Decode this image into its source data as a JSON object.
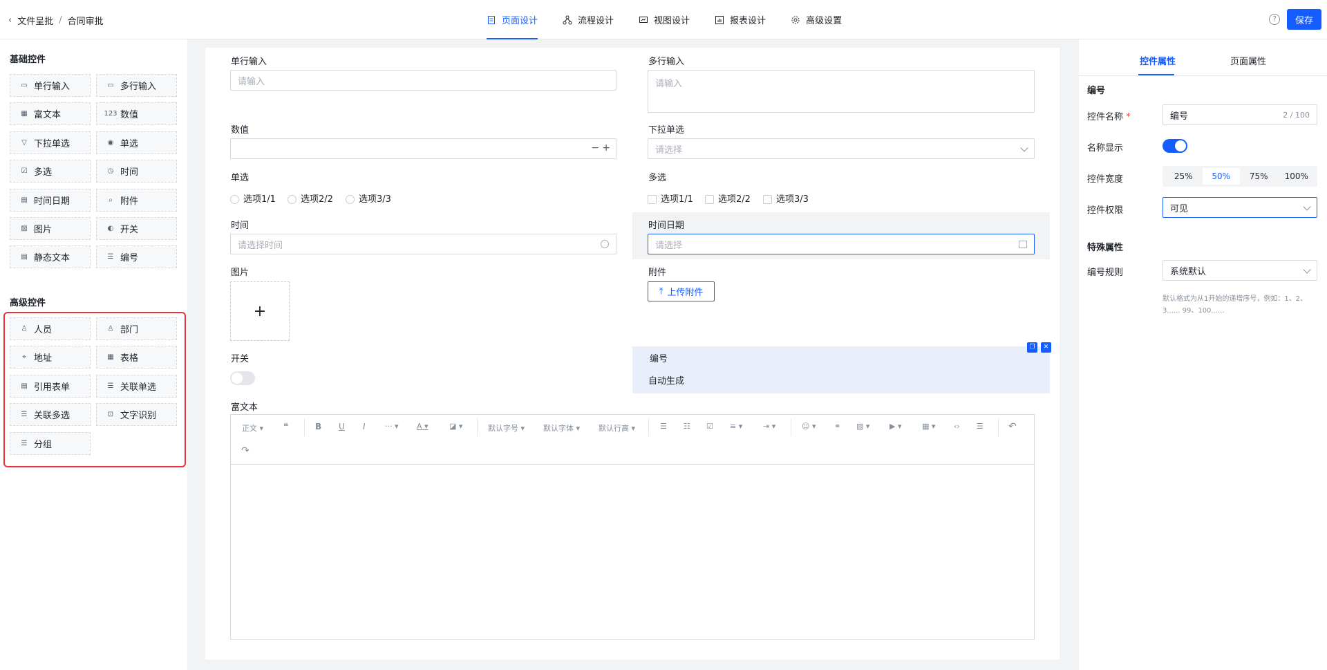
{
  "header": {
    "breadcrumb": [
      "文件呈批",
      "合同审批"
    ],
    "breadcrumb_sep": "/",
    "tabs": [
      {
        "label": "页面设计",
        "icon": "file-icon",
        "active": true
      },
      {
        "label": "流程设计",
        "icon": "flow-icon",
        "active": false
      },
      {
        "label": "视图设计",
        "icon": "view-icon",
        "active": false
      },
      {
        "label": "报表设计",
        "icon": "report-icon",
        "active": false
      },
      {
        "label": "高级设置",
        "icon": "gear-icon",
        "active": false
      }
    ],
    "help_icon": "?",
    "save_label": "保存",
    "accent": "#165dff"
  },
  "left": {
    "basic_title": "基础控件",
    "basic": [
      "单行输入",
      "多行输入",
      "富文本",
      "数值",
      "下拉单选",
      "单选",
      "多选",
      "时间",
      "时间日期",
      "附件",
      "图片",
      "开关",
      "静态文本",
      "编号"
    ],
    "basic_icons": [
      "▭",
      "▭",
      "▦",
      "123",
      "▽",
      "◉",
      "☑",
      "◷",
      "▤",
      "⌕",
      "▨",
      "◐",
      "▤",
      "☰"
    ],
    "advanced_title": "高级控件",
    "advanced": [
      "人员",
      "部门",
      "地址",
      "表格",
      "引用表单",
      "关联单选",
      "关联多选",
      "文字识别",
      "分组"
    ],
    "advanced_icons": [
      "♙",
      "♙",
      "⌖",
      "▦",
      "▤",
      "☰",
      "☰",
      "⊡",
      "☰"
    ],
    "highlight_color": "#e8333c"
  },
  "form": {
    "single_input": {
      "label": "单行输入",
      "placeholder": "请输入"
    },
    "multi_input": {
      "label": "多行输入",
      "placeholder": "请输入"
    },
    "number": {
      "label": "数值",
      "minus": "−",
      "plus": "+"
    },
    "dropdown": {
      "label": "下拉单选",
      "placeholder": "请选择"
    },
    "radio": {
      "label": "单选",
      "options": [
        "选项1/1",
        "选项2/2",
        "选项3/3"
      ]
    },
    "checkbox": {
      "label": "多选",
      "options": [
        "选项1/1",
        "选项2/2",
        "选项3/3"
      ]
    },
    "time": {
      "label": "时间",
      "placeholder": "请选择时间"
    },
    "datetime": {
      "label": "时间日期",
      "placeholder": "请选择"
    },
    "image": {
      "label": "图片",
      "plus": "+"
    },
    "attachment": {
      "label": "附件",
      "button": "上传附件"
    },
    "switch": {
      "label": "开关"
    },
    "serial": {
      "label": "编号",
      "value": "自动生成"
    },
    "richtext": {
      "label": "富文本",
      "toolbar": {
        "heading": "正文",
        "font_size": "默认字号",
        "font_family": "默认字体",
        "line_height": "默认行高"
      }
    }
  },
  "right": {
    "tabs": [
      "控件属性",
      "页面属性"
    ],
    "section_title": "编号",
    "name_label": "控件名称",
    "required_mark": "*",
    "name_value": "编号",
    "name_count": "2 / 100",
    "show_name_label": "名称显示",
    "switch_on": true,
    "width_label": "控件宽度",
    "width_options": [
      "25%",
      "50%",
      "75%",
      "100%"
    ],
    "width_selected": "50%",
    "perm_label": "控件权限",
    "perm_value": "可见",
    "special_title": "特殊属性",
    "rule_label": "编号规则",
    "rule_value": "系统默认",
    "hint": "默认格式为从1开始的递增序号，例如：1、2、3...... 99、100......"
  }
}
